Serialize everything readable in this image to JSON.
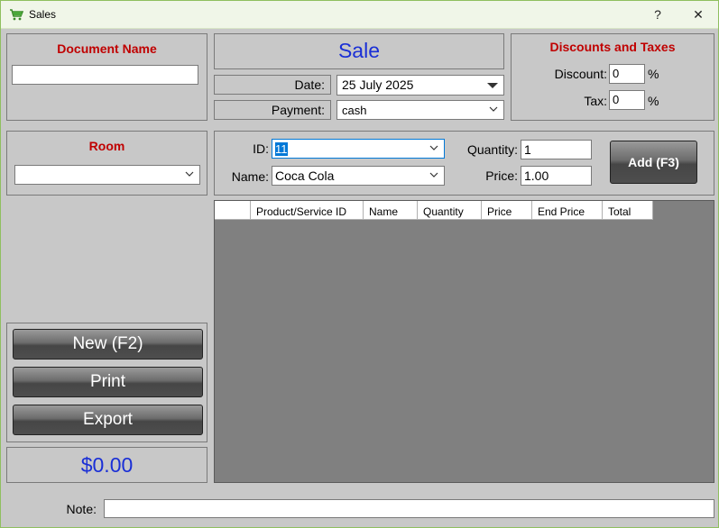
{
  "window": {
    "title": "Sales",
    "help_label": "?",
    "close_label": "✕",
    "icon": "shopping-cart-icon"
  },
  "document": {
    "heading": "Document Name",
    "value": ""
  },
  "sale": {
    "title": "Sale",
    "date_label": "Date:",
    "date_value": "25 July 2025",
    "payment_label": "Payment:",
    "payment_value": "cash"
  },
  "discounts": {
    "heading": "Discounts and Taxes",
    "discount_label": "Discount:",
    "discount_value": "0",
    "discount_unit": "%",
    "tax_label": "Tax:",
    "tax_value": "0",
    "tax_unit": "%"
  },
  "room": {
    "heading": "Room",
    "value": ""
  },
  "product": {
    "id_label": "ID:",
    "id_value": "11",
    "name_label": "Name:",
    "name_value": "Coca Cola",
    "quantity_label": "Quantity:",
    "quantity_value": "1",
    "price_label": "Price:",
    "price_value": "1.00",
    "add_label": "Add (F3)"
  },
  "grid": {
    "columns": [
      "",
      "Product/Service ID",
      "Name",
      "Quantity",
      "Price",
      "End Price",
      "Total"
    ]
  },
  "actions": {
    "new_label": "New (F2)",
    "print_label": "Print",
    "export_label": "Export"
  },
  "total": {
    "value": "$0.00"
  },
  "note": {
    "label": "Note:",
    "value": ""
  },
  "colors": {
    "heading_red": "#c00000",
    "sale_blue": "#1a2fd6",
    "total_blue": "#1a2fd6",
    "selection_blue": "#0078d7"
  }
}
